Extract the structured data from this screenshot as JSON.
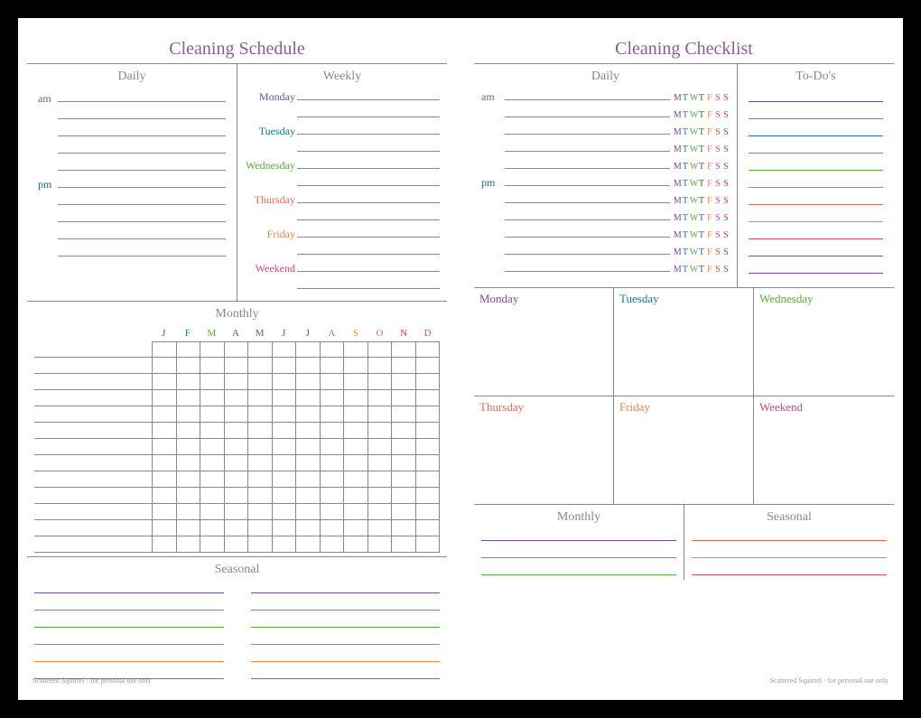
{
  "left": {
    "title": "Cleaning Schedule",
    "daily_label": "Daily",
    "weekly_label": "Weekly",
    "monthly_label": "Monthly",
    "seasonal_label": "Seasonal",
    "am": "am",
    "pm": "pm",
    "days": [
      {
        "name": "Monday",
        "class": "c-purple"
      },
      {
        "name": "Tuesday",
        "class": "c-teal"
      },
      {
        "name": "Wednesday",
        "class": "c-green"
      },
      {
        "name": "Thursday",
        "class": "c-coral"
      },
      {
        "name": "Friday",
        "class": "c-orange"
      },
      {
        "name": "Weekend",
        "class": "c-pink"
      }
    ],
    "months": [
      {
        "l": "J",
        "c": "c-navy"
      },
      {
        "l": "F",
        "c": "c-teal"
      },
      {
        "l": "M",
        "c": "c-green"
      },
      {
        "l": "A",
        "c": "c-magenta"
      },
      {
        "l": "M",
        "c": "c-purple"
      },
      {
        "l": "J",
        "c": "c-teal"
      },
      {
        "l": "J",
        "c": "c-navy"
      },
      {
        "l": "A",
        "c": "c-green"
      },
      {
        "l": "S",
        "c": "c-orange"
      },
      {
        "l": "O",
        "c": "c-coral"
      },
      {
        "l": "N",
        "c": "c-magenta"
      },
      {
        "l": "D",
        "c": "c-pink"
      }
    ],
    "seasonal_colors": [
      "bc-purple",
      "bc-cyan",
      "bc-green",
      "bc-coral",
      "bc-orange",
      "bc-pink"
    ],
    "credit": "Scattered Squirrel · for personal use only"
  },
  "right": {
    "title": "Cleaning Checklist",
    "daily_label": "Daily",
    "todo_label": "To-Do's",
    "monthly_label": "Monthly",
    "seasonal_label": "Seasonal",
    "am": "am",
    "pm": "pm",
    "week_letters": [
      {
        "l": "M",
        "c": "c-purple"
      },
      {
        "l": "T",
        "c": "c-teal"
      },
      {
        "l": "W",
        "c": "c-green"
      },
      {
        "l": "T",
        "c": "c-navy"
      },
      {
        "l": "F",
        "c": "c-orange"
      },
      {
        "l": "S",
        "c": "c-pink"
      },
      {
        "l": "S",
        "c": "c-magenta"
      }
    ],
    "todo_colors": [
      "bc-purple",
      "bc-cyan",
      "bc-teal",
      "bc-green",
      "bc-green",
      "bc-coral",
      "bc-coral",
      "bc-orange",
      "bc-pink",
      "bc-magenta",
      "bc-purple"
    ],
    "week_days": [
      {
        "name": "Monday",
        "c": "c-purple"
      },
      {
        "name": "Tuesday",
        "c": "c-teal"
      },
      {
        "name": "Wednesday",
        "c": "c-green"
      },
      {
        "name": "Thursday",
        "c": "c-coral"
      },
      {
        "name": "Friday",
        "c": "c-orange"
      },
      {
        "name": "Weekend",
        "c": "c-pink"
      }
    ],
    "monthly_colors": [
      "bc-purple",
      "bc-cyan",
      "bc-green"
    ],
    "seasonal_colors": [
      "bc-coral",
      "bc-orange",
      "bc-pink"
    ],
    "credit": "Scattered Squirrel · for personal use only"
  }
}
